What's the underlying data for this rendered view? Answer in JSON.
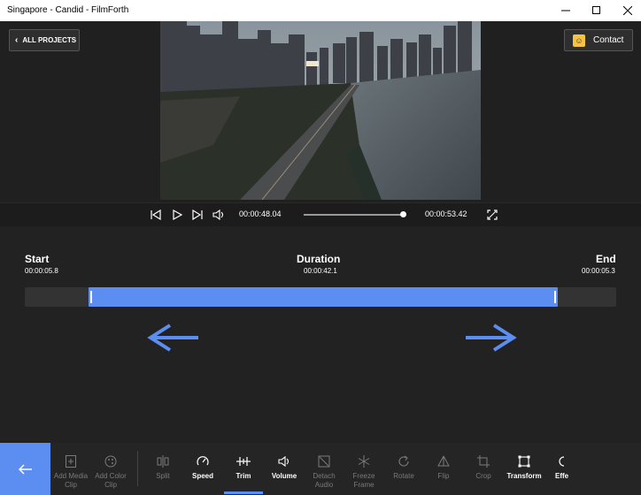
{
  "window": {
    "title": "Singapore - Candid - FilmForth"
  },
  "header": {
    "all_projects_label": "ALL PROJECTS",
    "contact_label": "Contact"
  },
  "player": {
    "current_time": "00:00:48.04",
    "total_time": "00:00:53.42",
    "progress": 0.9
  },
  "trim": {
    "start_label": "Start",
    "start_value": "00:00:05.8",
    "duration_label": "Duration",
    "duration_value": "00:00:42.1",
    "end_label": "End",
    "end_value": "00:00:05.3"
  },
  "toolbar": {
    "items": [
      {
        "label1": "Add Media",
        "label2": "Clip",
        "icon": "add-media-icon",
        "state": "dim"
      },
      {
        "label1": "Add Color",
        "label2": "Clip",
        "icon": "color-palette-icon",
        "state": "dim"
      },
      {
        "label1": "Split",
        "label2": "",
        "icon": "split-icon",
        "state": "dim"
      },
      {
        "label1": "Speed",
        "label2": "",
        "icon": "speed-icon",
        "state": "active"
      },
      {
        "label1": "Trim",
        "label2": "",
        "icon": "trim-icon",
        "state": "active"
      },
      {
        "label1": "Volume",
        "label2": "",
        "icon": "volume-icon",
        "state": "active"
      },
      {
        "label1": "Detach",
        "label2": "Audio",
        "icon": "detach-audio-icon",
        "state": "dim"
      },
      {
        "label1": "Freeze",
        "label2": "Frame",
        "icon": "snowflake-icon",
        "state": "dim"
      },
      {
        "label1": "Rotate",
        "label2": "",
        "icon": "rotate-icon",
        "state": "dim"
      },
      {
        "label1": "Flip",
        "label2": "",
        "icon": "flip-icon",
        "state": "dim"
      },
      {
        "label1": "Crop",
        "label2": "",
        "icon": "crop-icon",
        "state": "dim"
      },
      {
        "label1": "Transform",
        "label2": "",
        "icon": "transform-icon",
        "state": "active"
      },
      {
        "label1": "Effe",
        "label2": "",
        "icon": "effects-icon",
        "state": "active"
      }
    ]
  },
  "colors": {
    "accent": "#5b8ef0",
    "background": "#222222"
  }
}
